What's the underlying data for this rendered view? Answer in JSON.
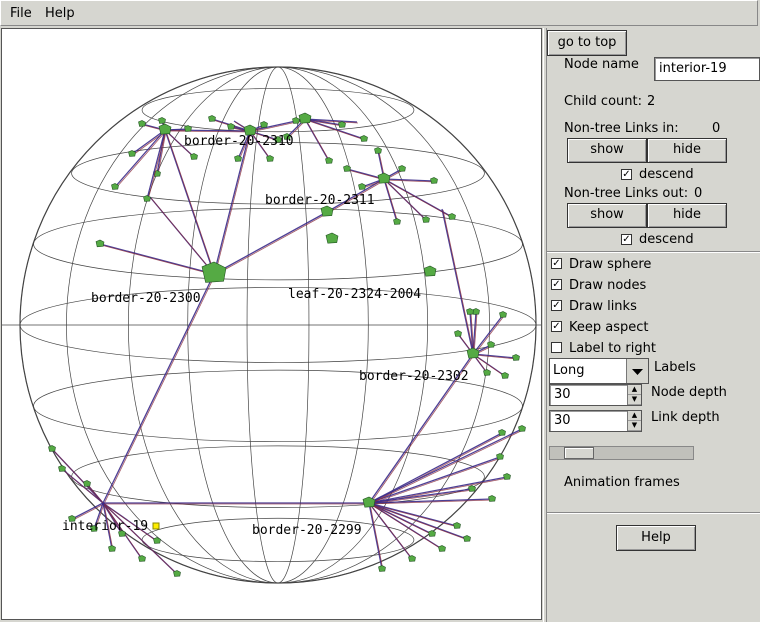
{
  "menu": {
    "file": "File",
    "help": "Help"
  },
  "panel": {
    "go_to_top": "go to top",
    "node_name_label": "Node name",
    "node_name_value": "interior-19",
    "child_count_label": "Child count:",
    "child_count_value": "2",
    "links_in_label": "Non-tree Links in:",
    "links_in_value": "0",
    "show": "show",
    "hide": "hide",
    "descend": "descend",
    "links_out_label": "Non-tree Links out:",
    "links_out_value": "0",
    "draw_sphere": "Draw sphere",
    "draw_nodes": "Draw nodes",
    "draw_links": "Draw links",
    "keep_aspect": "Keep aspect",
    "label_to_right": "Label to right",
    "labels_mode": "Long",
    "labels_label": "Labels",
    "node_depth_value": "30",
    "node_depth_label": "Node depth",
    "link_depth_value": "30",
    "link_depth_label": "Link depth",
    "animation_frames": "Animation frames",
    "help_button": "Help"
  },
  "checkboxes": {
    "descend_in": true,
    "descend_out": true,
    "draw_sphere": true,
    "draw_nodes": true,
    "draw_links": true,
    "keep_aspect": true,
    "label_to_right": false
  },
  "animation_frames_fraction": 0.12,
  "graph": {
    "labels": {
      "border_2310": "border-20-2310",
      "border_2311": "border-20-2311",
      "border_2300": "border-20-2300",
      "leaf_2324": "leaf-20-2324-2004",
      "border_2302": "border-20-2302",
      "interior_19": "interior-19",
      "border_2299": "border-20-2299"
    },
    "colors": {
      "node": "#55aa44",
      "link_a": "#3a2a8a",
      "link_b": "#8a2a3a",
      "sphere": "#444444",
      "selected": "#ffee00"
    }
  }
}
